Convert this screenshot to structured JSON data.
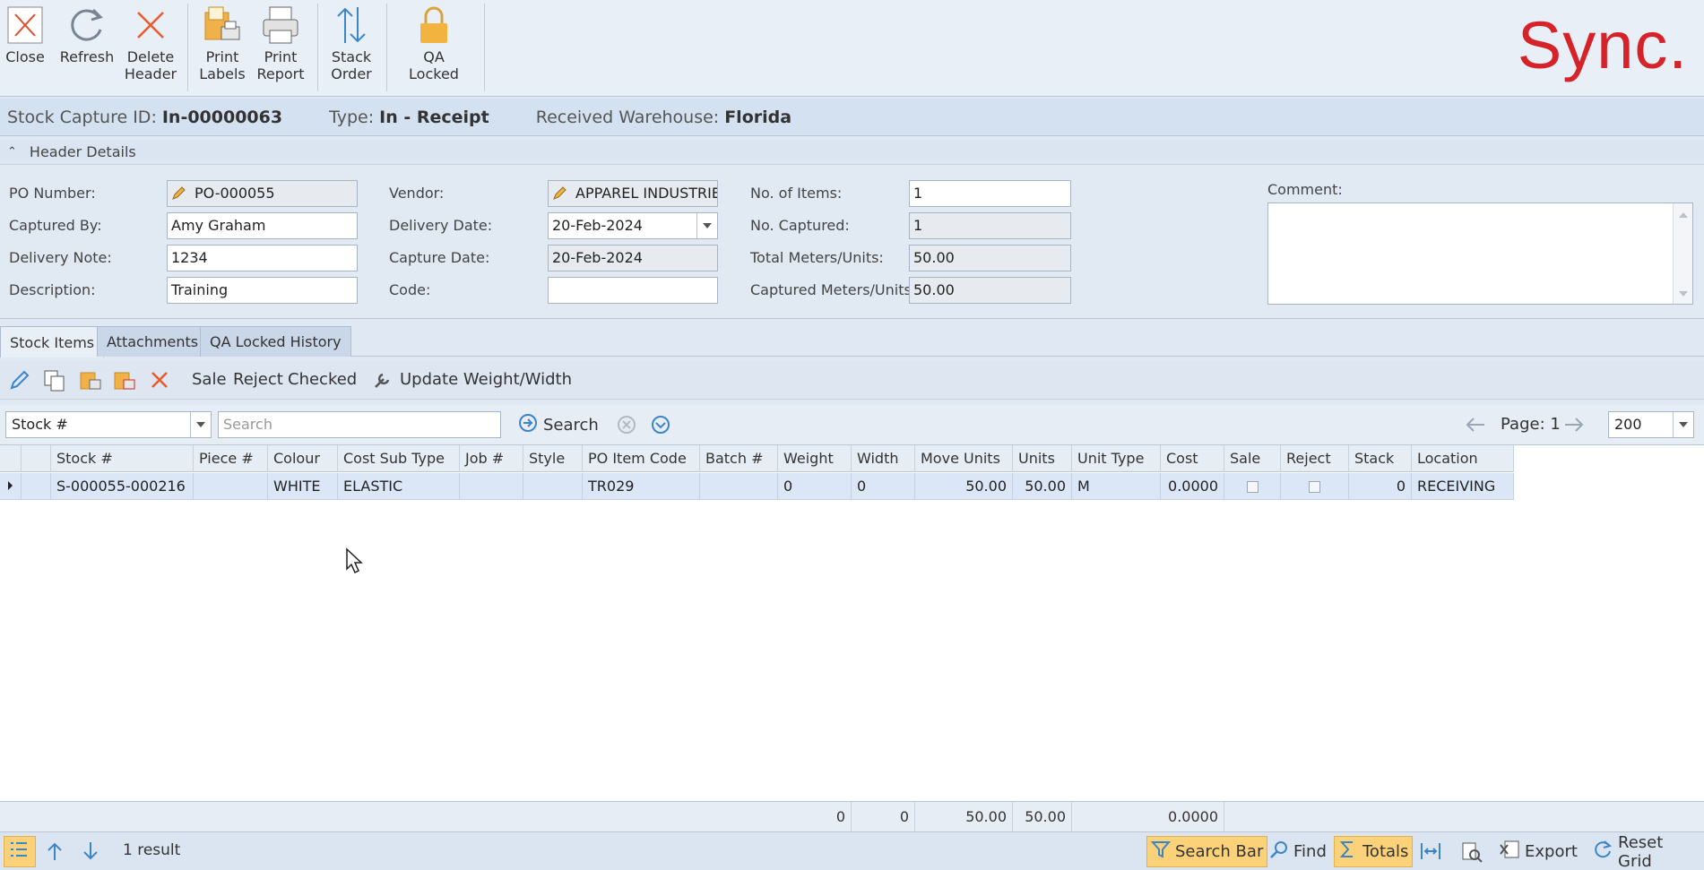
{
  "ribbon": {
    "close": "Close",
    "refresh": "Refresh",
    "delete_header_1": "Delete",
    "delete_header_2": "Header",
    "print_labels_1": "Print",
    "print_labels_2": "Labels",
    "print_report_1": "Print",
    "print_report_2": "Report",
    "stack_order_1": "Stack",
    "stack_order_2": "Order",
    "qa_locked": "QA Locked",
    "logo": "Sync."
  },
  "info": {
    "capture_id_label": "Stock Capture ID:",
    "capture_id": "In-00000063",
    "type_label": "Type:",
    "type": "In - Receipt",
    "warehouse_label": "Received Warehouse:",
    "warehouse": "Florida"
  },
  "header_details": {
    "title": "Header Details",
    "po_number_label": "PO Number:",
    "po_number": "PO-000055",
    "captured_by_label": "Captured By:",
    "captured_by": "Amy Graham",
    "delivery_note_label": "Delivery Note:",
    "delivery_note": "1234",
    "description_label": "Description:",
    "description": "Training",
    "vendor_label": "Vendor:",
    "vendor": "APPAREL INDUSTRIE",
    "delivery_date_label": "Delivery Date:",
    "delivery_date": "20-Feb-2024",
    "capture_date_label": "Capture Date:",
    "capture_date": "20-Feb-2024",
    "code_label": "Code:",
    "code": "",
    "items_label": "No. of Items:",
    "items": "1",
    "captured_label": "No. Captured:",
    "captured": "1",
    "total_units_label": "Total Meters/Units:",
    "total_units": "50.00",
    "captured_units_label": "Captured Meters/Units:",
    "captured_units": "50.00",
    "comment_label": "Comment:",
    "comment": ""
  },
  "tabs": [
    "Stock Items",
    "Attachments",
    "QA Locked History"
  ],
  "toolbar": {
    "sale": "Sale",
    "reject": "Reject",
    "checked": "Checked",
    "update_weight": "Update Weight/Width"
  },
  "search": {
    "field": "Stock #",
    "placeholder": "Search",
    "button": "Search",
    "page_label": "Page: 1",
    "page_size": "200"
  },
  "grid": {
    "columns": [
      "Stock #",
      "Piece #",
      "Colour",
      "Cost Sub Type",
      "Job #",
      "Style",
      "PO Item Code",
      "Batch #",
      "Weight",
      "Width",
      "Move Units",
      "Units",
      "Unit Type",
      "Cost",
      "Sale",
      "Reject",
      "Stack",
      "Location"
    ],
    "row": {
      "stock": "S-000055-000216",
      "piece": "",
      "colour": "WHITE",
      "cost_sub_type": "ELASTIC",
      "job": "",
      "style": "",
      "po_item_code": "TR029",
      "batch": "",
      "weight": "0",
      "width": "0",
      "move_units": "50.00",
      "units": "50.00",
      "unit_type": "M",
      "cost": "0.0000",
      "stack": "0",
      "location": "RECEIVING"
    },
    "totals": {
      "weight": "0",
      "width": "0",
      "move_units": "50.00",
      "units": "50.00",
      "cost": "0.0000"
    }
  },
  "status": {
    "result": "1 result",
    "search_bar": "Search Bar",
    "find": "Find",
    "totals": "Totals",
    "export": "Export",
    "reset_grid": "Reset Grid"
  },
  "colors": {
    "accent": "#2f80c8",
    "logo": "#d6232a",
    "highlight": "#fbd27a"
  }
}
